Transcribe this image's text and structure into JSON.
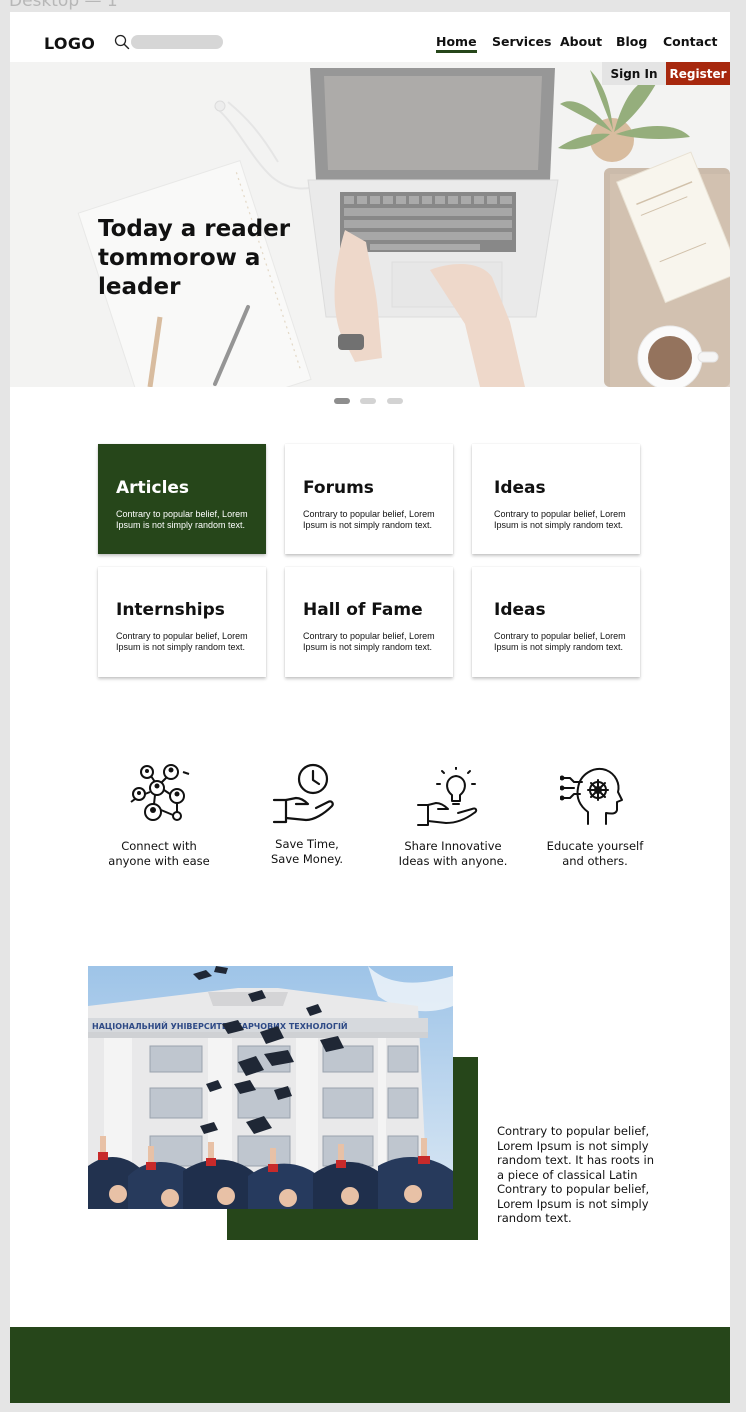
{
  "frame_label": "Desktop — 1",
  "header": {
    "logo": "LOGO",
    "search_placeholder": "",
    "nav": [
      {
        "label": "Home",
        "active": true
      },
      {
        "label": "Services"
      },
      {
        "label": "About"
      },
      {
        "label": "Blog"
      },
      {
        "label": "Contact"
      }
    ]
  },
  "hero": {
    "title": "Today a reader tommorow a leader",
    "signin_label": "Sign In",
    "register_label": "Register",
    "slides": 3,
    "active_slide": 1
  },
  "cards": [
    {
      "title": "Articles",
      "desc": "Contrary to popular belief, Lorem Ipsum is not simply random text.",
      "featured": true
    },
    {
      "title": "Forums",
      "desc": "Contrary to popular belief, Lorem Ipsum is not simply random text."
    },
    {
      "title": "Ideas",
      "desc": "Contrary to popular belief, Lorem Ipsum is not simply random text."
    },
    {
      "title": "Internships",
      "desc": "Contrary to popular belief, Lorem Ipsum is not simply random text."
    },
    {
      "title": "Hall of Fame",
      "desc": "Contrary to popular belief, Lorem Ipsum is not simply random text."
    },
    {
      "title": "Ideas",
      "desc": "Contrary to popular belief, Lorem Ipsum is not simply random text."
    }
  ],
  "features": [
    {
      "icon": "network-people-icon",
      "line1": "Connect with",
      "line2": "anyone with ease"
    },
    {
      "icon": "hand-clock-icon",
      "line1": "Save Time,",
      "line2": "Save Money."
    },
    {
      "icon": "hand-lightbulb-icon",
      "line1": "Share Innovative",
      "line2": "Ideas with anyone."
    },
    {
      "icon": "head-brain-icon",
      "line1": "Educate yourself",
      "line2": "and others."
    }
  ],
  "promo": {
    "building_sign": "НАЦІОНАЛЬНИЙ УНІВЕРСИТЕТ ХАРЧОВИХ ТЕХНОЛОГІЙ",
    "text": "Contrary to popular belief, Lorem Ipsum is not simply random text. It has roots in a piece of classical Latin Contrary to popular belief, Lorem Ipsum is not simply random text."
  },
  "colors": {
    "brand_green": "#26461a",
    "register_red": "#a7280e",
    "search_bar": "#d6d6d6"
  }
}
